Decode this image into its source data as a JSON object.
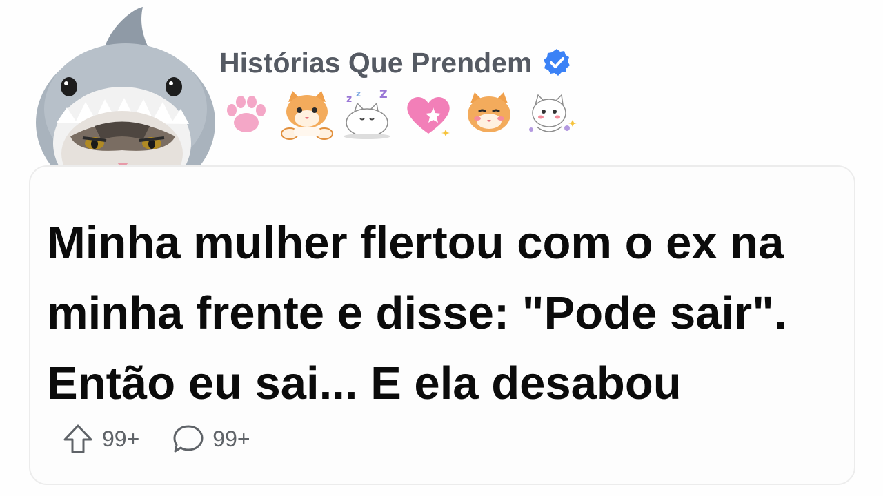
{
  "channel": {
    "name": "Histórias Que Prendem",
    "verified_color": "#3b82f6",
    "stickers": [
      "paw-print",
      "orange-cat-waving",
      "sleeping-white-cat",
      "pink-heart",
      "orange-cat-smiling",
      "white-cat-sparkle"
    ]
  },
  "post": {
    "lines": [
      "Minha mulher flertou com o ex na",
      "minha frente e disse: \"Pode sair\".",
      "Então eu sai... E ela desabou"
    ]
  },
  "actions": {
    "upvote_count": "99+",
    "comment_count": "99+"
  }
}
